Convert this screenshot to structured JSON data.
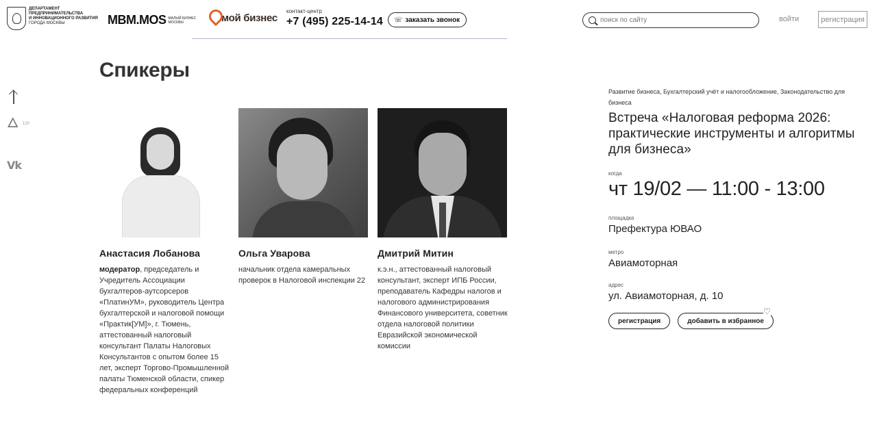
{
  "header": {
    "dept_logo_lines": [
      "Департамент",
      "предпринимательства",
      "и инновационного развития"
    ],
    "dept_logo_sub": "города Москвы",
    "mbm_name": "MBM.MOS",
    "mbm_tag": "малый бизнес Москвы",
    "moy_biznes": "мой бизнес",
    "contact_label": "контакт-центр",
    "phone": "+7 (495) 225-14-14",
    "callback_label": "заказать звонок",
    "search_placeholder": "поиск по сайту",
    "login_label": "войти",
    "register_label": "регистрация"
  },
  "rail": {
    "fire_count": "120",
    "vk_label": "Vk"
  },
  "page": {
    "title": "Спикеры"
  },
  "speakers": [
    {
      "name": "Анастасия Лобанова",
      "role": "модератор",
      "bio": ", председатель и Учредитель Ассоциации бухгалтеров-аутсорсеров «ПлатинУМ», руководитель Центра бухгалтерской и налоговой помощи «Практик[УМ]», г. Тюмень, аттестованный налоговый консультант Палаты Налоговых Консультантов с опытом более 15 лет, эксперт Торгово-Промышленной палаты Тюменской области, спикер федеральных конференций"
    },
    {
      "name": "Ольга Уварова",
      "bio": "начальник отдела камеральных проверок в Налоговой инспекции 22"
    },
    {
      "name": "Дмитрий Митин",
      "bio": "к.э.н., аттестованный налоговый консультант, эксперт ИПБ России, преподаватель Кафедры налогов и налогового администрирования Финансового университета, советник отдела налоговой политики Евразийской экономической комиссии"
    }
  ],
  "event": {
    "tags": "Развитие бизнеса, Бухгалтерский учёт и налогообложение, Законодательство для бизнеса",
    "title": "Встреча «Налоговая реформа 2026: практические инструменты и алгоритмы для бизнеса»",
    "when_label": "когда",
    "when_value": "чт 19/02 — 11:00 - 13:00",
    "place_label": "площадка",
    "place_value": "Префектура ЮВАО",
    "metro_label": "метро",
    "metro_value": "Авиамоторная",
    "address_label": "адрес",
    "address_value": "ул. Авиамоторная, д. 10",
    "register_button": "регистрация",
    "favorite_button": "добавить в избранное"
  }
}
